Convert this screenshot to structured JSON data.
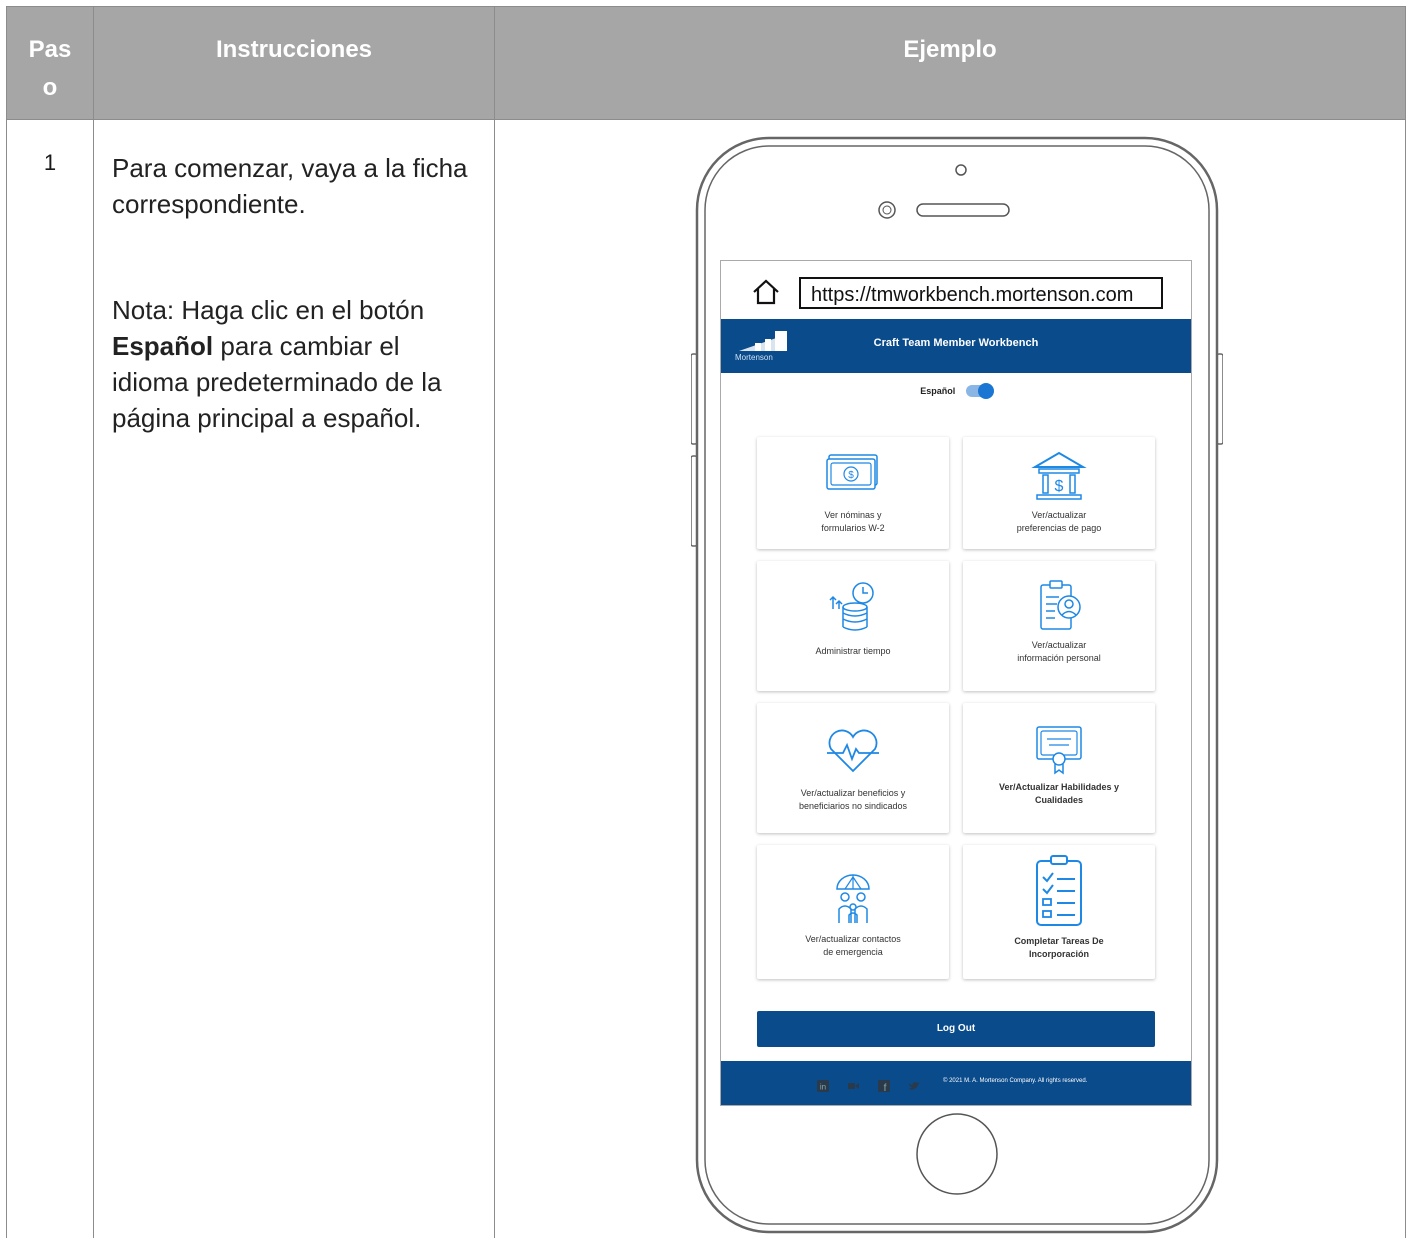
{
  "table": {
    "headers": {
      "step": "Pas\no",
      "instructions": "Instrucciones",
      "example": "Ejemplo"
    },
    "rows": [
      {
        "step": "1",
        "instruction_1": "Para comenzar, vaya a la ficha correspondiente.",
        "instruction_2_pre": "Nota: Haga clic en el botón ",
        "instruction_2_bold": "Español",
        "instruction_2_post": " para cambiar el idioma predeterminado de la página principal a español."
      }
    ]
  },
  "phone": {
    "url": "https://tmworkbench.mortenson.com",
    "app": {
      "logo_text": "Mortenson",
      "title": "Craft Team Member Workbench",
      "toggle_label": "Español",
      "toggle_on": true,
      "tiles": [
        {
          "icon": "money-bill-icon",
          "line1": "Ver nóminas y",
          "line2": "formularios W-2"
        },
        {
          "icon": "bank-icon",
          "line1": "Ver/actualizar",
          "line2": "preferencias de pago"
        },
        {
          "icon": "coins-clock-icon",
          "line1": "Administrar tiempo",
          "line2": ""
        },
        {
          "icon": "clipboard-person-icon",
          "line1": "Ver/actualizar",
          "line2": "información personal"
        },
        {
          "icon": "heart-pulse-icon",
          "line1": "Ver/actualizar beneficios y",
          "line2": "beneficiarios no sindicados"
        },
        {
          "icon": "certificate-icon",
          "line1": "Ver/Actualizar Habilidades y",
          "line2": "Cualidades"
        },
        {
          "icon": "family-umbrella-icon",
          "line1": "Ver/actualizar contactos",
          "line2": "de emergencia"
        },
        {
          "icon": "checklist-icon",
          "line1": "Completar Tareas De",
          "line2": "Incorporación"
        }
      ],
      "logout_label": "Log Out",
      "footer": {
        "icons": [
          "linkedin-icon",
          "video-icon",
          "facebook-icon",
          "twitter-icon"
        ],
        "copyright": "© 2021 M. A. Mortenson Company. All rights reserved."
      }
    }
  },
  "colors": {
    "header_bg": "#a6a6a6",
    "brand_blue": "#0a4b8c",
    "icon_blue": "#1e88e5",
    "toggle_blue": "#1976d2"
  }
}
